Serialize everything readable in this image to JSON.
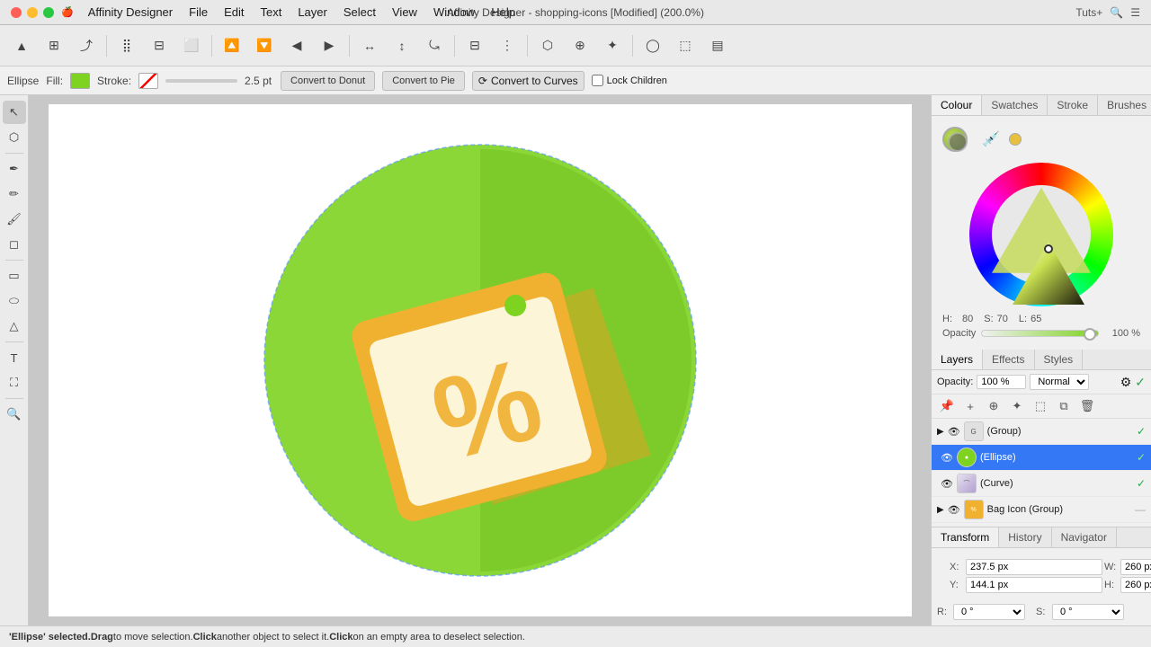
{
  "titlebar": {
    "app_name": "Affinity Designer",
    "title": "Affinity Designer - shopping-icons [Modified] (200.0%)",
    "menu": [
      "Apple",
      "Affinity Designer",
      "File",
      "Edit",
      "Text",
      "Layer",
      "Select",
      "View",
      "Window",
      "Help"
    ],
    "right": "Tuts+"
  },
  "propbar": {
    "shape_label": "Ellipse",
    "fill_label": "Fill:",
    "stroke_label": "Stroke:",
    "stroke_value": "2.5 pt",
    "btn_donut": "Convert to Donut",
    "btn_pie": "Convert to Pie",
    "btn_curves": "Convert to Curves",
    "lock_children": "Lock Children"
  },
  "color_panel": {
    "tabs": [
      "Colour",
      "Swatches",
      "Stroke",
      "Brushes"
    ],
    "active_tab": "Colour",
    "hue": 80,
    "saturation": 70,
    "lightness": 65,
    "opacity": 100,
    "opacity_label": "Opacity"
  },
  "layers_panel": {
    "tabs": [
      "Layers",
      "Effects",
      "Styles"
    ],
    "active_tab": "Layers",
    "opacity_label": "Opacity:",
    "opacity_value": "100 %",
    "blend_mode": "Normal",
    "items": [
      {
        "name": "(Group)",
        "type": "group",
        "visible": true,
        "selected": false,
        "checked": true
      },
      {
        "name": "(Ellipse)",
        "type": "ellipse",
        "visible": true,
        "selected": true,
        "checked": true
      },
      {
        "name": "(Curve)",
        "type": "curve",
        "visible": true,
        "selected": false,
        "checked": true
      },
      {
        "name": "Bag Icon (Group)",
        "type": "group",
        "visible": true,
        "selected": false,
        "checked": false
      }
    ]
  },
  "transform_panel": {
    "tabs": [
      "Transform",
      "History",
      "Navigator"
    ],
    "active_tab": "Transform",
    "x_label": "X:",
    "x_value": "237.5 px",
    "y_label": "Y:",
    "y_value": "144.1 px",
    "w_label": "W:",
    "w_value": "260 px",
    "h_label": "H:",
    "h_value": "260 px",
    "r_label": "R:",
    "r_value": "0 °",
    "s_label": "S:",
    "s_value": "0 °"
  },
  "statusbar": {
    "text": "'Ellipse' selected. ",
    "drag_text": "Drag",
    "drag_desc": " to move selection. ",
    "click_text": "Click",
    "click_desc": " another object to select it. ",
    "click2_text": "Click",
    "click2_desc": " on an empty area to deselect selection."
  },
  "toolbar_icons": {
    "affinity_logo": "▲",
    "move": "⊕",
    "transform": "⊞",
    "more": "⋯"
  }
}
